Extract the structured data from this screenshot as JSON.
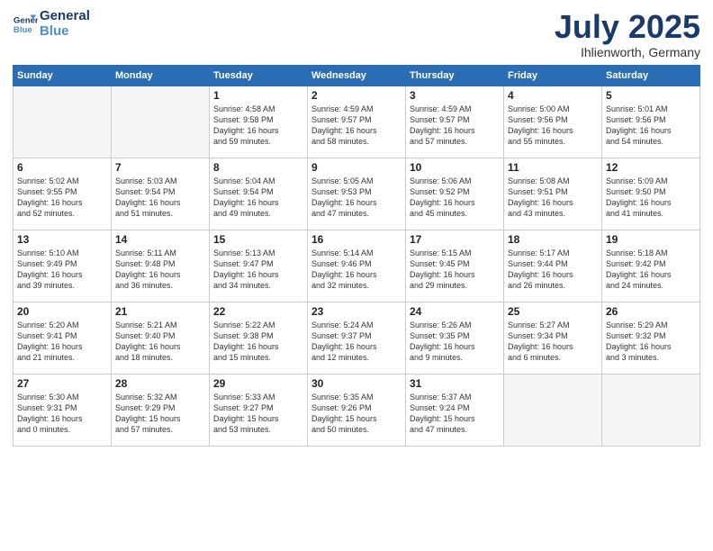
{
  "header": {
    "logo_line1": "General",
    "logo_line2": "Blue",
    "month_title": "July 2025",
    "subtitle": "Ihlienworth, Germany"
  },
  "weekdays": [
    "Sunday",
    "Monday",
    "Tuesday",
    "Wednesday",
    "Thursday",
    "Friday",
    "Saturday"
  ],
  "weeks": [
    [
      {
        "day": "",
        "info": ""
      },
      {
        "day": "",
        "info": ""
      },
      {
        "day": "1",
        "info": "Sunrise: 4:58 AM\nSunset: 9:58 PM\nDaylight: 16 hours\nand 59 minutes."
      },
      {
        "day": "2",
        "info": "Sunrise: 4:59 AM\nSunset: 9:57 PM\nDaylight: 16 hours\nand 58 minutes."
      },
      {
        "day": "3",
        "info": "Sunrise: 4:59 AM\nSunset: 9:57 PM\nDaylight: 16 hours\nand 57 minutes."
      },
      {
        "day": "4",
        "info": "Sunrise: 5:00 AM\nSunset: 9:56 PM\nDaylight: 16 hours\nand 55 minutes."
      },
      {
        "day": "5",
        "info": "Sunrise: 5:01 AM\nSunset: 9:56 PM\nDaylight: 16 hours\nand 54 minutes."
      }
    ],
    [
      {
        "day": "6",
        "info": "Sunrise: 5:02 AM\nSunset: 9:55 PM\nDaylight: 16 hours\nand 52 minutes."
      },
      {
        "day": "7",
        "info": "Sunrise: 5:03 AM\nSunset: 9:54 PM\nDaylight: 16 hours\nand 51 minutes."
      },
      {
        "day": "8",
        "info": "Sunrise: 5:04 AM\nSunset: 9:54 PM\nDaylight: 16 hours\nand 49 minutes."
      },
      {
        "day": "9",
        "info": "Sunrise: 5:05 AM\nSunset: 9:53 PM\nDaylight: 16 hours\nand 47 minutes."
      },
      {
        "day": "10",
        "info": "Sunrise: 5:06 AM\nSunset: 9:52 PM\nDaylight: 16 hours\nand 45 minutes."
      },
      {
        "day": "11",
        "info": "Sunrise: 5:08 AM\nSunset: 9:51 PM\nDaylight: 16 hours\nand 43 minutes."
      },
      {
        "day": "12",
        "info": "Sunrise: 5:09 AM\nSunset: 9:50 PM\nDaylight: 16 hours\nand 41 minutes."
      }
    ],
    [
      {
        "day": "13",
        "info": "Sunrise: 5:10 AM\nSunset: 9:49 PM\nDaylight: 16 hours\nand 39 minutes."
      },
      {
        "day": "14",
        "info": "Sunrise: 5:11 AM\nSunset: 9:48 PM\nDaylight: 16 hours\nand 36 minutes."
      },
      {
        "day": "15",
        "info": "Sunrise: 5:13 AM\nSunset: 9:47 PM\nDaylight: 16 hours\nand 34 minutes."
      },
      {
        "day": "16",
        "info": "Sunrise: 5:14 AM\nSunset: 9:46 PM\nDaylight: 16 hours\nand 32 minutes."
      },
      {
        "day": "17",
        "info": "Sunrise: 5:15 AM\nSunset: 9:45 PM\nDaylight: 16 hours\nand 29 minutes."
      },
      {
        "day": "18",
        "info": "Sunrise: 5:17 AM\nSunset: 9:44 PM\nDaylight: 16 hours\nand 26 minutes."
      },
      {
        "day": "19",
        "info": "Sunrise: 5:18 AM\nSunset: 9:42 PM\nDaylight: 16 hours\nand 24 minutes."
      }
    ],
    [
      {
        "day": "20",
        "info": "Sunrise: 5:20 AM\nSunset: 9:41 PM\nDaylight: 16 hours\nand 21 minutes."
      },
      {
        "day": "21",
        "info": "Sunrise: 5:21 AM\nSunset: 9:40 PM\nDaylight: 16 hours\nand 18 minutes."
      },
      {
        "day": "22",
        "info": "Sunrise: 5:22 AM\nSunset: 9:38 PM\nDaylight: 16 hours\nand 15 minutes."
      },
      {
        "day": "23",
        "info": "Sunrise: 5:24 AM\nSunset: 9:37 PM\nDaylight: 16 hours\nand 12 minutes."
      },
      {
        "day": "24",
        "info": "Sunrise: 5:26 AM\nSunset: 9:35 PM\nDaylight: 16 hours\nand 9 minutes."
      },
      {
        "day": "25",
        "info": "Sunrise: 5:27 AM\nSunset: 9:34 PM\nDaylight: 16 hours\nand 6 minutes."
      },
      {
        "day": "26",
        "info": "Sunrise: 5:29 AM\nSunset: 9:32 PM\nDaylight: 16 hours\nand 3 minutes."
      }
    ],
    [
      {
        "day": "27",
        "info": "Sunrise: 5:30 AM\nSunset: 9:31 PM\nDaylight: 16 hours\nand 0 minutes."
      },
      {
        "day": "28",
        "info": "Sunrise: 5:32 AM\nSunset: 9:29 PM\nDaylight: 15 hours\nand 57 minutes."
      },
      {
        "day": "29",
        "info": "Sunrise: 5:33 AM\nSunset: 9:27 PM\nDaylight: 15 hours\nand 53 minutes."
      },
      {
        "day": "30",
        "info": "Sunrise: 5:35 AM\nSunset: 9:26 PM\nDaylight: 15 hours\nand 50 minutes."
      },
      {
        "day": "31",
        "info": "Sunrise: 5:37 AM\nSunset: 9:24 PM\nDaylight: 15 hours\nand 47 minutes."
      },
      {
        "day": "",
        "info": ""
      },
      {
        "day": "",
        "info": ""
      }
    ]
  ]
}
